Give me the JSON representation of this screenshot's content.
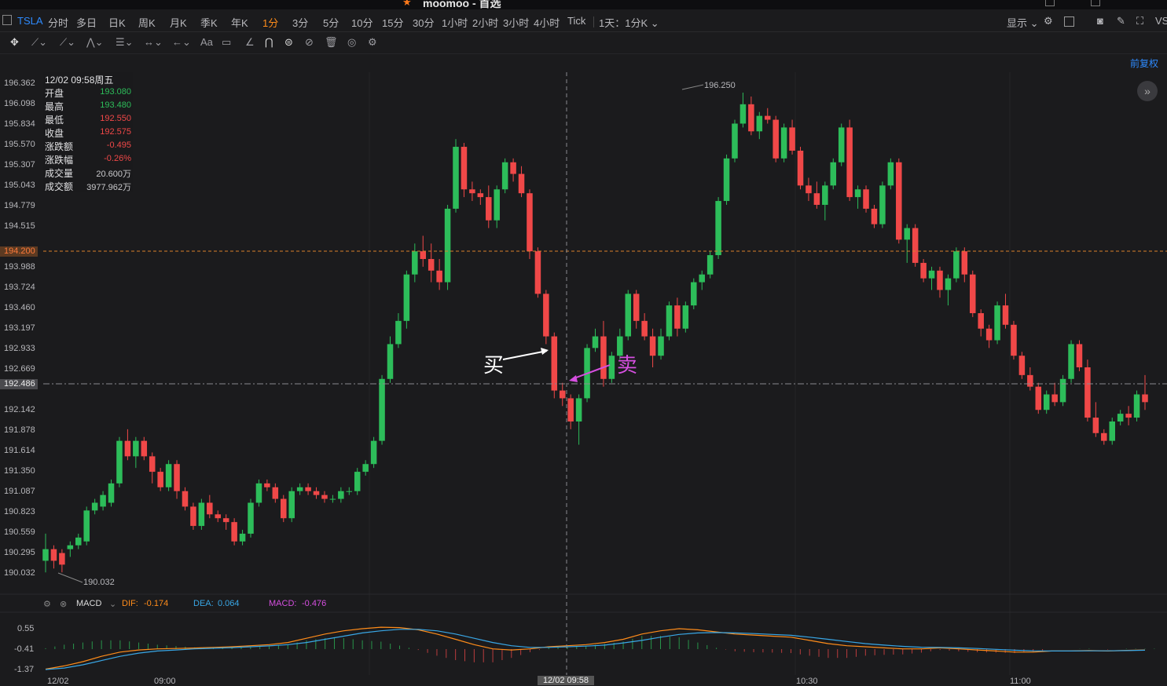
{
  "app_title": "moomoo - 首选",
  "periods": {
    "symbol": "TSLA",
    "items": [
      "分时",
      "多日",
      "日K",
      "周K",
      "月K",
      "季K",
      "年K",
      "1分",
      "3分",
      "5分",
      "10分",
      "15分",
      "30分",
      "1小时",
      "2小时",
      "3小时",
      "4小时",
      "Tick"
    ],
    "active": "1分",
    "range_label": "1天：1分K ⌄",
    "display_label": "显示 ⌄"
  },
  "tools": {
    "text_tool": "Aa"
  },
  "restore_label": "前复权",
  "info_panel": {
    "date": "12/02 09:58周五",
    "rows": [
      {
        "key": "开盘",
        "value": "193.080",
        "color": "#2dbd5a"
      },
      {
        "key": "最高",
        "value": "193.480",
        "color": "#2dbd5a"
      },
      {
        "key": "最低",
        "value": "192.550",
        "color": "#f04848"
      },
      {
        "key": "收盘",
        "value": "192.575",
        "color": "#f04848"
      },
      {
        "key": "涨跌额",
        "value": "-0.495",
        "color": "#f04848"
      },
      {
        "key": "涨跌幅",
        "value": "-0.26%",
        "color": "#f04848"
      },
      {
        "key": "成交量",
        "value": "20.600万",
        "color": "#c9c9cc"
      },
      {
        "key": "成交额",
        "value": "3977.962万",
        "color": "#c9c9cc"
      }
    ]
  },
  "price_axis": {
    "ticks": [
      "196.362",
      "196.098",
      "195.834",
      "195.570",
      "195.307",
      "195.043",
      "194.779",
      "194.515",
      "193.988",
      "193.724",
      "193.460",
      "193.197",
      "192.933",
      "192.669",
      "192.142",
      "191.878",
      "191.614",
      "191.350",
      "191.087",
      "190.823",
      "190.559",
      "190.295",
      "190.032"
    ],
    "prev_close_tag": "194.200",
    "cross_tag": "192.486"
  },
  "annotations": {
    "buy": "买",
    "sell": "卖",
    "high_label": "196.250",
    "low_label": "190.032"
  },
  "macd": {
    "name": "MACD",
    "dif_label": "DIF:",
    "dif_value": "-0.174",
    "dea_label": "DEA:",
    "dea_value": "0.064",
    "macd_label": "MACD:",
    "macd_value": "-0.476",
    "ticks": [
      "0.55",
      "-0.41",
      "-1.37"
    ],
    "dif": [
      -1.35,
      -1.2,
      -1.0,
      -0.75,
      -0.55,
      -0.45,
      -0.4,
      -0.38,
      -0.36,
      -0.33,
      -0.3,
      -0.25,
      -0.2,
      -0.1,
      0.1,
      0.3,
      0.45,
      0.55,
      0.62,
      0.6,
      0.5,
      0.3,
      0.05,
      -0.2,
      -0.4,
      -0.45,
      -0.4,
      -0.3,
      -0.25,
      -0.2,
      -0.1,
      0.05,
      0.3,
      0.45,
      0.55,
      0.5,
      0.4,
      0.3,
      0.25,
      0.2,
      0.15,
      0.0,
      -0.15,
      -0.25,
      -0.3,
      -0.35,
      -0.4,
      -0.4,
      -0.35,
      -0.4,
      -0.45,
      -0.5,
      -0.55,
      -0.55,
      -0.5,
      -0.5,
      -0.48,
      -0.5,
      -0.47,
      -0.45
    ],
    "dea": [
      -1.37,
      -1.3,
      -1.15,
      -0.95,
      -0.75,
      -0.6,
      -0.5,
      -0.45,
      -0.4,
      -0.37,
      -0.34,
      -0.3,
      -0.26,
      -0.2,
      -0.1,
      0.05,
      0.2,
      0.35,
      0.45,
      0.52,
      0.52,
      0.45,
      0.3,
      0.1,
      -0.1,
      -0.25,
      -0.33,
      -0.33,
      -0.3,
      -0.27,
      -0.22,
      -0.12,
      0.0,
      0.15,
      0.28,
      0.35,
      0.37,
      0.35,
      0.32,
      0.28,
      0.24,
      0.15,
      0.05,
      -0.05,
      -0.15,
      -0.22,
      -0.28,
      -0.32,
      -0.33,
      -0.35,
      -0.38,
      -0.42,
      -0.46,
      -0.49,
      -0.5,
      -0.5,
      -0.49,
      -0.49,
      -0.48,
      -0.46
    ]
  },
  "x_axis": {
    "labels": [
      "12/02",
      "09:00",
      "10:30",
      "11:00"
    ],
    "cross_label": "12/02 09:58"
  },
  "chart_data": {
    "type": "candlestick",
    "ylim": [
      189.9,
      196.5
    ],
    "up_color": "#2dbd5a",
    "down_color": "#f04848",
    "prev_close": 194.2,
    "cross_price": 192.486,
    "candles": [
      [
        190.2,
        190.55,
        190.05,
        190.35
      ],
      [
        190.35,
        190.4,
        190.1,
        190.2
      ],
      [
        190.3,
        190.35,
        190.05,
        190.15
      ],
      [
        190.35,
        190.45,
        190.25,
        190.4
      ],
      [
        190.4,
        190.55,
        190.35,
        190.5
      ],
      [
        190.45,
        190.9,
        190.4,
        190.85
      ],
      [
        190.85,
        191.0,
        190.8,
        190.95
      ],
      [
        190.9,
        191.1,
        190.85,
        191.05
      ],
      [
        190.95,
        191.25,
        190.9,
        191.2
      ],
      [
        191.2,
        191.8,
        191.15,
        191.75
      ],
      [
        191.75,
        191.9,
        191.5,
        191.55
      ],
      [
        191.55,
        191.8,
        191.4,
        191.75
      ],
      [
        191.75,
        191.8,
        191.5,
        191.55
      ],
      [
        191.55,
        191.6,
        191.2,
        191.35
      ],
      [
        191.35,
        191.4,
        191.1,
        191.15
      ],
      [
        191.15,
        191.5,
        191.1,
        191.45
      ],
      [
        191.45,
        191.5,
        191.0,
        191.1
      ],
      [
        191.1,
        191.15,
        190.85,
        190.9
      ],
      [
        190.9,
        190.95,
        190.6,
        190.65
      ],
      [
        190.65,
        191.0,
        190.6,
        190.95
      ],
      [
        190.95,
        191.05,
        190.75,
        190.8
      ],
      [
        190.8,
        190.85,
        190.7,
        190.75
      ],
      [
        190.75,
        190.8,
        190.6,
        190.7
      ],
      [
        190.7,
        190.75,
        190.4,
        190.45
      ],
      [
        190.45,
        190.6,
        190.4,
        190.55
      ],
      [
        190.55,
        191.0,
        190.5,
        190.95
      ],
      [
        190.95,
        191.25,
        190.9,
        191.2
      ],
      [
        191.2,
        191.25,
        191.1,
        191.15
      ],
      [
        191.15,
        191.2,
        190.95,
        191.0
      ],
      [
        191.0,
        191.05,
        190.7,
        190.75
      ],
      [
        190.75,
        191.15,
        190.7,
        191.1
      ],
      [
        191.1,
        191.2,
        191.05,
        191.15
      ],
      [
        191.15,
        191.2,
        191.05,
        191.1
      ],
      [
        191.1,
        191.15,
        191.0,
        191.05
      ],
      [
        191.05,
        191.1,
        190.95,
        191.0
      ],
      [
        191.0,
        191.05,
        190.95,
        191.0
      ],
      [
        191.0,
        191.15,
        190.95,
        191.1
      ],
      [
        191.1,
        191.15,
        191.05,
        191.1
      ],
      [
        191.1,
        191.4,
        191.05,
        191.35
      ],
      [
        191.35,
        191.5,
        191.3,
        191.45
      ],
      [
        191.45,
        191.8,
        191.4,
        191.75
      ],
      [
        191.75,
        192.6,
        191.7,
        192.55
      ],
      [
        192.55,
        193.1,
        192.5,
        193.0
      ],
      [
        193.0,
        193.4,
        192.95,
        193.3
      ],
      [
        193.3,
        193.95,
        193.2,
        193.9
      ],
      [
        193.9,
        194.3,
        193.8,
        194.2
      ],
      [
        194.2,
        194.4,
        194.0,
        194.1
      ],
      [
        194.1,
        194.3,
        193.8,
        193.95
      ],
      [
        193.95,
        194.1,
        193.7,
        193.8
      ],
      [
        193.8,
        194.8,
        193.7,
        194.75
      ],
      [
        194.75,
        195.65,
        194.7,
        195.55
      ],
      [
        195.55,
        195.6,
        194.9,
        195.0
      ],
      [
        195.0,
        195.1,
        194.85,
        194.95
      ],
      [
        194.95,
        195.0,
        194.8,
        194.9
      ],
      [
        194.9,
        195.05,
        194.5,
        194.6
      ],
      [
        194.6,
        195.05,
        194.5,
        195.0
      ],
      [
        195.0,
        195.4,
        194.95,
        195.35
      ],
      [
        195.35,
        195.4,
        195.1,
        195.2
      ],
      [
        195.2,
        195.3,
        194.9,
        194.95
      ],
      [
        194.95,
        195.0,
        194.1,
        194.2
      ],
      [
        194.2,
        194.25,
        193.6,
        193.65
      ],
      [
        193.65,
        193.7,
        193.0,
        193.1
      ],
      [
        193.1,
        193.15,
        192.3,
        192.4
      ],
      [
        192.4,
        192.5,
        192.2,
        192.3
      ],
      [
        192.3,
        192.35,
        191.9,
        192.0
      ],
      [
        192.0,
        192.35,
        191.7,
        192.3
      ],
      [
        192.3,
        193.0,
        192.25,
        192.95
      ],
      [
        192.95,
        193.2,
        192.9,
        193.1
      ],
      [
        193.1,
        193.3,
        192.45,
        192.55
      ],
      [
        192.55,
        192.9,
        192.5,
        192.85
      ],
      [
        192.85,
        193.2,
        192.8,
        193.1
      ],
      [
        193.1,
        193.7,
        193.05,
        193.65
      ],
      [
        193.65,
        193.7,
        193.2,
        193.3
      ],
      [
        193.3,
        193.4,
        193.05,
        193.1
      ],
      [
        193.1,
        193.2,
        192.7,
        192.85
      ],
      [
        192.85,
        193.2,
        192.8,
        193.1
      ],
      [
        193.1,
        193.55,
        193.05,
        193.5
      ],
      [
        193.5,
        193.6,
        193.1,
        193.2
      ],
      [
        193.2,
        193.55,
        193.15,
        193.5
      ],
      [
        193.5,
        193.85,
        193.45,
        193.8
      ],
      [
        193.8,
        193.95,
        193.7,
        193.9
      ],
      [
        193.9,
        194.2,
        193.85,
        194.15
      ],
      [
        194.15,
        194.9,
        194.1,
        194.85
      ],
      [
        194.85,
        195.45,
        194.8,
        195.4
      ],
      [
        195.4,
        195.9,
        195.35,
        195.85
      ],
      [
        195.85,
        196.25,
        195.8,
        196.1
      ],
      [
        196.1,
        196.2,
        195.7,
        195.75
      ],
      [
        195.75,
        196.0,
        195.65,
        195.95
      ],
      [
        195.95,
        196.05,
        195.85,
        195.9
      ],
      [
        195.9,
        195.95,
        195.35,
        195.4
      ],
      [
        195.4,
        195.85,
        195.35,
        195.8
      ],
      [
        195.8,
        195.9,
        195.45,
        195.5
      ],
      [
        195.5,
        195.55,
        195.0,
        195.05
      ],
      [
        195.05,
        195.15,
        194.85,
        194.95
      ],
      [
        194.95,
        195.1,
        194.75,
        194.8
      ],
      [
        194.8,
        195.1,
        194.6,
        195.05
      ],
      [
        195.05,
        195.4,
        195.0,
        195.35
      ],
      [
        195.35,
        195.85,
        195.3,
        195.8
      ],
      [
        195.8,
        195.9,
        194.85,
        194.9
      ],
      [
        194.9,
        195.05,
        194.75,
        195.0
      ],
      [
        195.0,
        195.05,
        194.7,
        194.75
      ],
      [
        194.75,
        194.8,
        194.5,
        194.55
      ],
      [
        194.55,
        195.1,
        194.5,
        195.05
      ],
      [
        195.05,
        195.4,
        195.0,
        195.35
      ],
      [
        195.35,
        195.4,
        194.3,
        194.35
      ],
      [
        194.35,
        194.55,
        194.05,
        194.5
      ],
      [
        194.5,
        194.55,
        194.0,
        194.05
      ],
      [
        194.05,
        194.1,
        193.8,
        193.85
      ],
      [
        193.85,
        194.0,
        193.7,
        193.95
      ],
      [
        193.95,
        194.0,
        193.6,
        193.7
      ],
      [
        193.7,
        193.9,
        193.5,
        193.85
      ],
      [
        193.85,
        194.25,
        193.8,
        194.2
      ],
      [
        194.2,
        194.25,
        193.8,
        193.9
      ],
      [
        193.9,
        193.95,
        193.35,
        193.4
      ],
      [
        193.4,
        193.45,
        193.1,
        193.2
      ],
      [
        193.2,
        193.25,
        192.95,
        193.05
      ],
      [
        193.05,
        193.55,
        193.0,
        193.5
      ],
      [
        193.5,
        193.65,
        193.2,
        193.25
      ],
      [
        193.25,
        193.3,
        192.8,
        192.85
      ],
      [
        192.85,
        192.9,
        192.55,
        192.6
      ],
      [
        192.6,
        192.7,
        192.4,
        192.45
      ],
      [
        192.45,
        192.5,
        192.1,
        192.15
      ],
      [
        192.15,
        192.4,
        192.1,
        192.35
      ],
      [
        192.35,
        192.5,
        192.2,
        192.25
      ],
      [
        192.25,
        192.6,
        192.2,
        192.55
      ],
      [
        192.55,
        193.05,
        192.5,
        193.0
      ],
      [
        193.0,
        193.05,
        192.65,
        192.7
      ],
      [
        192.7,
        192.8,
        192.0,
        192.05
      ],
      [
        192.05,
        192.25,
        191.8,
        191.85
      ],
      [
        191.85,
        191.9,
        191.7,
        191.75
      ],
      [
        191.75,
        192.05,
        191.7,
        192.0
      ],
      [
        192.0,
        192.15,
        191.95,
        192.1
      ],
      [
        192.1,
        192.2,
        191.95,
        192.05
      ],
      [
        192.05,
        192.4,
        192.0,
        192.35
      ],
      [
        192.35,
        192.6,
        192.15,
        192.25
      ]
    ]
  }
}
